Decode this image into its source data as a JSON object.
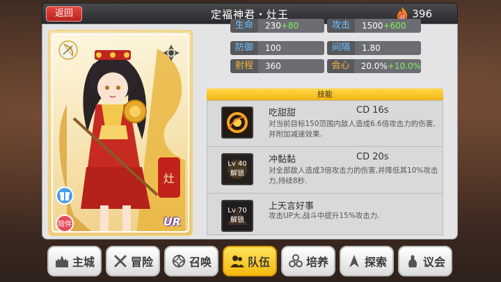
{
  "header": {
    "back_label": "返回",
    "title": "定福神君・灶王",
    "power_value": "396",
    "power_icon_label": "战"
  },
  "card": {
    "rarity_label": "UR",
    "gift_badge_icon": "gift-icon",
    "accompany_badge_label": "陪伴",
    "class_icon": "bow-icon",
    "element_icon": "wind-element-icon"
  },
  "stats": [
    {
      "name": "生命",
      "value": "230",
      "bonus": "+80",
      "name_color": "#6ec0ff"
    },
    {
      "name": "攻击",
      "value": "1500",
      "bonus": "+600",
      "name_color": "#6ec0ff"
    },
    {
      "name": "防御",
      "value": "100",
      "bonus": "",
      "name_color": "#6ec0ff"
    },
    {
      "name": "间隔",
      "value": "1.80",
      "bonus": "",
      "name_color": "#6ec0ff"
    },
    {
      "name": "射程",
      "value": "360",
      "bonus": "",
      "name_color": "#f4b33d"
    },
    {
      "name": "会心",
      "value": "20.0%",
      "bonus": "+10.0%",
      "name_color": "#f4b33d"
    }
  ],
  "skills": {
    "header": "技能",
    "items": [
      {
        "name": "吃甜甜",
        "cd": "CD  16s",
        "desc": "对当前目标150范围内敌人造成6.6倍攻击力的伤害,并附加减速效果.",
        "lock_level": "",
        "lock_text": ""
      },
      {
        "name": "冲黏黏",
        "cd": "CD  20s",
        "desc": "对全部敌人造成3倍攻击力的伤害,并降低其10%攻击力,持续8秒.",
        "lock_level": "Lv 40",
        "lock_text": "解锁"
      },
      {
        "name": "上天言好事",
        "cd": "",
        "desc": "攻击UP大,战斗中提升15%攻击力.",
        "lock_level": "Lv 70",
        "lock_text": "解锁"
      }
    ]
  },
  "nav": [
    {
      "label": "主城",
      "icon": "castle-icon",
      "active": false
    },
    {
      "label": "冒险",
      "icon": "crossed-swords-icon",
      "active": false
    },
    {
      "label": "召唤",
      "icon": "summon-circle-icon",
      "active": false
    },
    {
      "label": "队伍",
      "icon": "team-icon",
      "active": true
    },
    {
      "label": "培养",
      "icon": "training-icon",
      "active": false
    },
    {
      "label": "探索",
      "icon": "explore-icon",
      "active": false
    },
    {
      "label": "议会",
      "icon": "council-icon",
      "active": false
    }
  ],
  "colors": {
    "accent_gold": "#f5b90f",
    "back_red": "#d8352e",
    "bonus_green": "#7cf25a"
  }
}
